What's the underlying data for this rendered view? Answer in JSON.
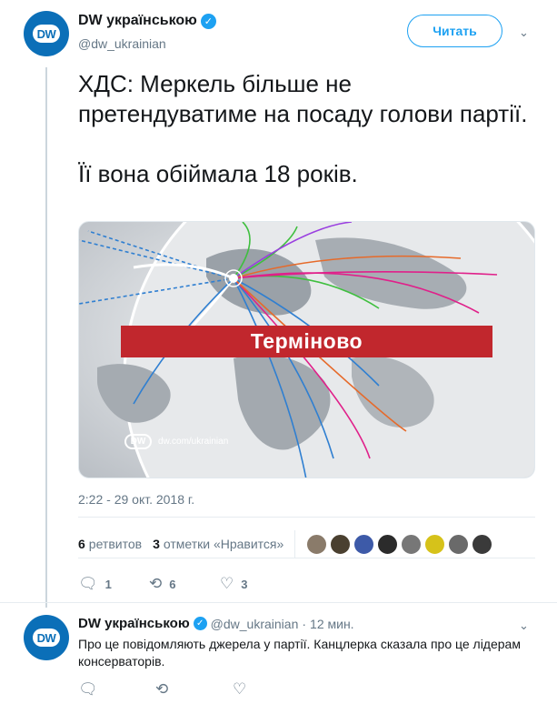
{
  "main_tweet": {
    "author_name": "DW українською",
    "handle": "@dw_ukrainian",
    "follow_label": "Читать",
    "text_paragraphs": [
      "ХДС: Меркель більше не претендуватиме на посаду голови партії.",
      "Її вона обіймала 18 років."
    ],
    "media": {
      "banner_text": "Терміново",
      "logo_text": "DW",
      "site_text": "dw.com/ukrainian"
    },
    "timestamp": "2:22 - 29 окт. 2018 г.",
    "stats": {
      "retweets_count": "6",
      "retweets_label": "ретвитов",
      "likes_count": "3",
      "likes_label": "отметки «Нравится»"
    },
    "liker_avatar_colors": [
      "#8a7b6a",
      "#4a4030",
      "#3d5aa8",
      "#2b2b2b",
      "#777777",
      "#d6c21a",
      "#6a6a6a",
      "#3a3a3a"
    ],
    "actions": {
      "reply_count": "1",
      "retweet_count": "6",
      "like_count": "3"
    }
  },
  "reply_tweet": {
    "author_name": "DW українською",
    "handle": "@dw_ukrainian",
    "separator": "·",
    "time": "12 мин.",
    "text": "Про це повідомляють джерела у партії. Канцлерка сказала про це лідерам консерваторів."
  },
  "icons": {
    "verified": "verified-badge-icon",
    "caret": "chevron-down-icon",
    "reply": "reply-icon",
    "retweet": "retweet-icon",
    "like": "heart-icon"
  },
  "colors": {
    "brand_blue": "#0b6fb8",
    "twitter_blue": "#1da1f2",
    "breaking_red": "#c1272d"
  }
}
